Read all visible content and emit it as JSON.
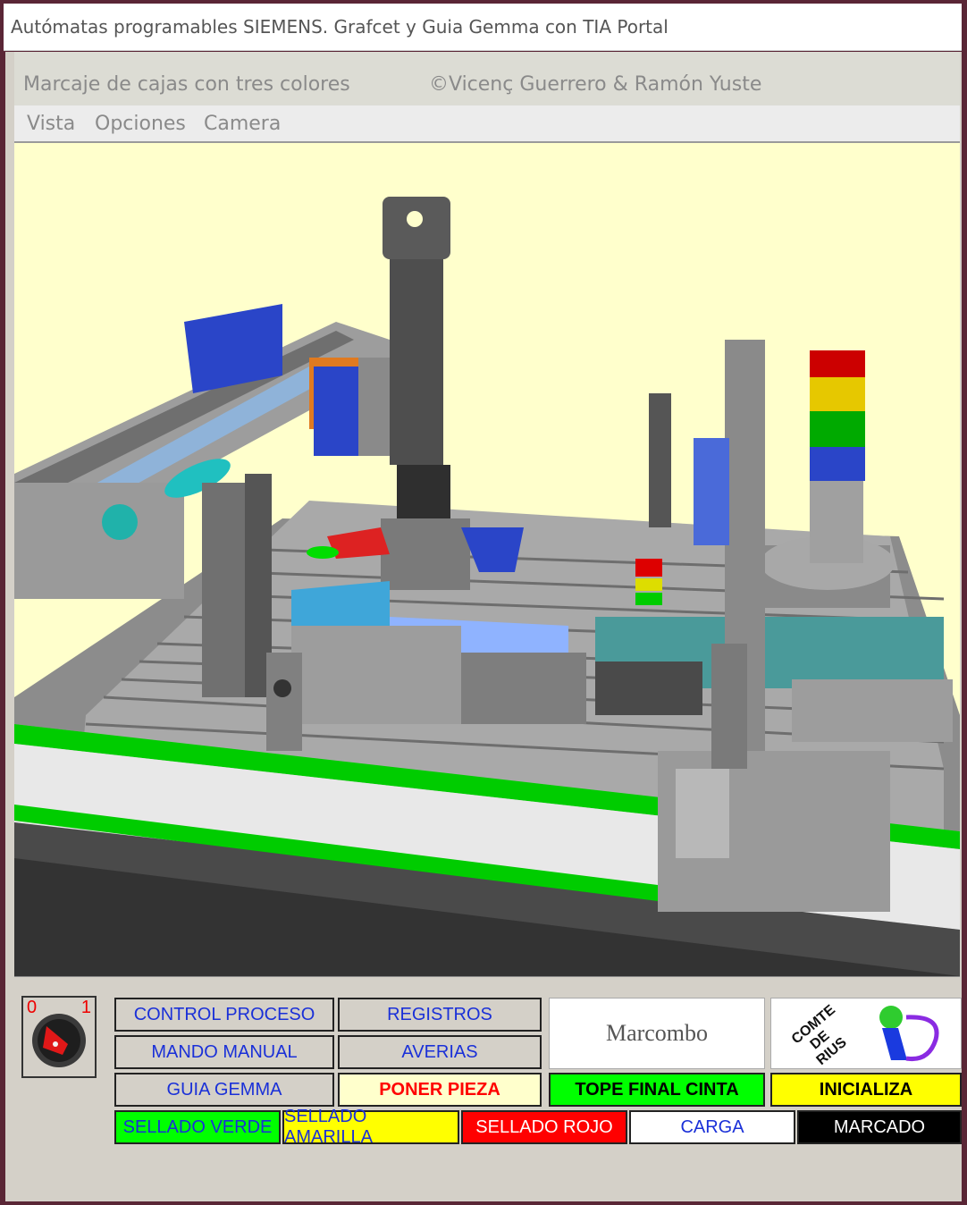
{
  "window": {
    "title": "Autómatas programables SIEMENS. Grafcet y Guia Gemma con TIA Portal"
  },
  "header": {
    "subtitle": "Marcaje de cajas con tres colores",
    "copyright": "©Vicenç Guerrero & Ramón Yuste"
  },
  "menu": {
    "items": [
      "Vista",
      "Opciones",
      "Camera"
    ]
  },
  "keyswitch": {
    "label_off": "0",
    "label_on": "1"
  },
  "buttons": {
    "control_proceso": "CONTROL PROCESO",
    "registros": "REGISTROS",
    "mando_manual": "MANDO MANUAL",
    "averias": "AVERIAS",
    "guia_gemma": "GUIA GEMMA",
    "poner_pieza": "PONER PIEZA",
    "tope_final": "TOPE FINAL CINTA",
    "inicializa": "INICIALIZA"
  },
  "indicators": {
    "sellado_verde": "SELLADO VERDE",
    "sellado_amarilla": "SELLADO AMARILLA",
    "sellado_rojo": "SELLADO  ROJO",
    "carga": "CARGA",
    "marcado": "MARCADO"
  },
  "logos": {
    "marcombo": "Marcombo",
    "comte": "COMTE DE RIUS"
  },
  "colors": {
    "green": "#00ff00",
    "yellow": "#ffff00",
    "red": "#ff0000",
    "black": "#000000",
    "scene_bg": "#ffffcc"
  }
}
